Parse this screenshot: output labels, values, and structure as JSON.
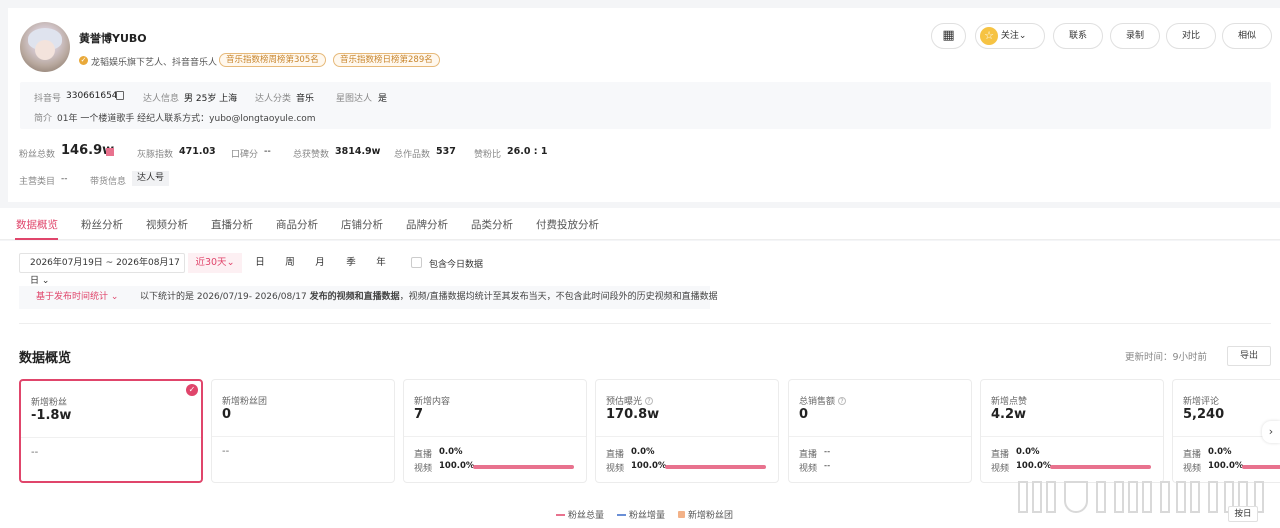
{
  "profile": {
    "name": "黄誉博YUBO",
    "desc": "龙韬娱乐旗下艺人、抖音音乐人",
    "tags": [
      "音乐指数榜周榜第305名",
      "音乐指数榜日榜第289名"
    ],
    "info": {
      "douyin_label": "抖音号",
      "douyin_value": "330661654",
      "talent_label": "达人信息",
      "talent_value": "男 25岁 上海",
      "category_label": "达人分类",
      "category_value": "音乐",
      "star_label": "星图达人",
      "star_value": "是",
      "intro_label": "简介",
      "intro_value": "01年 一个楼道歌手 经纪人联系方式：yubo@longtaoyule.com"
    },
    "stats": [
      {
        "label": "粉丝总数",
        "value": "146.9w"
      },
      {
        "label": "灰豚指数",
        "value": "471.03"
      },
      {
        "label": "口碑分",
        "value": "--"
      },
      {
        "label": "总获赞数",
        "value": "3814.9w"
      },
      {
        "label": "总作品数",
        "value": "537"
      },
      {
        "label": "赞粉比",
        "value": "26.0 : 1"
      }
    ],
    "main_cat_label": "主营类目",
    "main_cat_value": "--",
    "goods_label": "带货信息",
    "goods_value": "达人号",
    "buttons": {
      "follow": "关注",
      "contact": "联系",
      "record": "录制",
      "compare": "对比",
      "similar": "相似"
    }
  },
  "tabs": [
    "数据概览",
    "粉丝分析",
    "视频分析",
    "直播分析",
    "商品分析",
    "店铺分析",
    "品牌分析",
    "品类分析",
    "付费投放分析"
  ],
  "filters": {
    "date_range": "2026年07月19日 ~ 2026年08月17日",
    "ranges": [
      "近30天",
      "日",
      "周",
      "月",
      "季",
      "年"
    ],
    "include_today": "包含今日数据",
    "stat_by": "基于发布时间统计",
    "notice_prefix": "以下统计的是 2026/07/19- 2026/08/17 ",
    "notice_bold": "发布的视频和直播数据",
    "notice_suffix": "，视频/直播数据均统计至其发布当天，不包含此时间段外的历史视频和直播数据"
  },
  "overview": {
    "title": "数据概览",
    "update": "更新时间：9小时前",
    "export": "导出"
  },
  "cards": [
    {
      "label": "新增粉丝",
      "value": "-1.8w",
      "sub": "--"
    },
    {
      "label": "新增粉丝团",
      "value": "0",
      "sub": "--"
    },
    {
      "label": "新增内容",
      "value": "7",
      "live_label": "直播",
      "live": "0.0%",
      "video_label": "视频",
      "video": "100.0%",
      "video_frac": 1.0
    },
    {
      "label": "预估曝光",
      "value": "170.8w",
      "live_label": "直播",
      "live": "0.0%",
      "video_label": "视频",
      "video": "100.0%",
      "video_frac": 1.0
    },
    {
      "label": "总销售额",
      "value": "0",
      "live_label": "直播",
      "live": "--",
      "video_label": "视频",
      "video": "--"
    },
    {
      "label": "新增点赞",
      "value": "4.2w",
      "live_label": "直播",
      "live": "0.0%",
      "video_label": "视频",
      "video": "100.0%",
      "video_frac": 1.0
    },
    {
      "label": "新增评论",
      "value": "5,240",
      "live_label": "直播",
      "live": "0.0%",
      "video_label": "视频",
      "video": "100.0%",
      "video_frac": 1.0
    }
  ],
  "legend": [
    {
      "label": "粉丝总量",
      "color": "#e8728e"
    },
    {
      "label": "粉丝增量",
      "color": "#6a8fd6"
    },
    {
      "label": "新增粉丝团",
      "color": "#f3b288"
    }
  ],
  "day_button": "按日"
}
